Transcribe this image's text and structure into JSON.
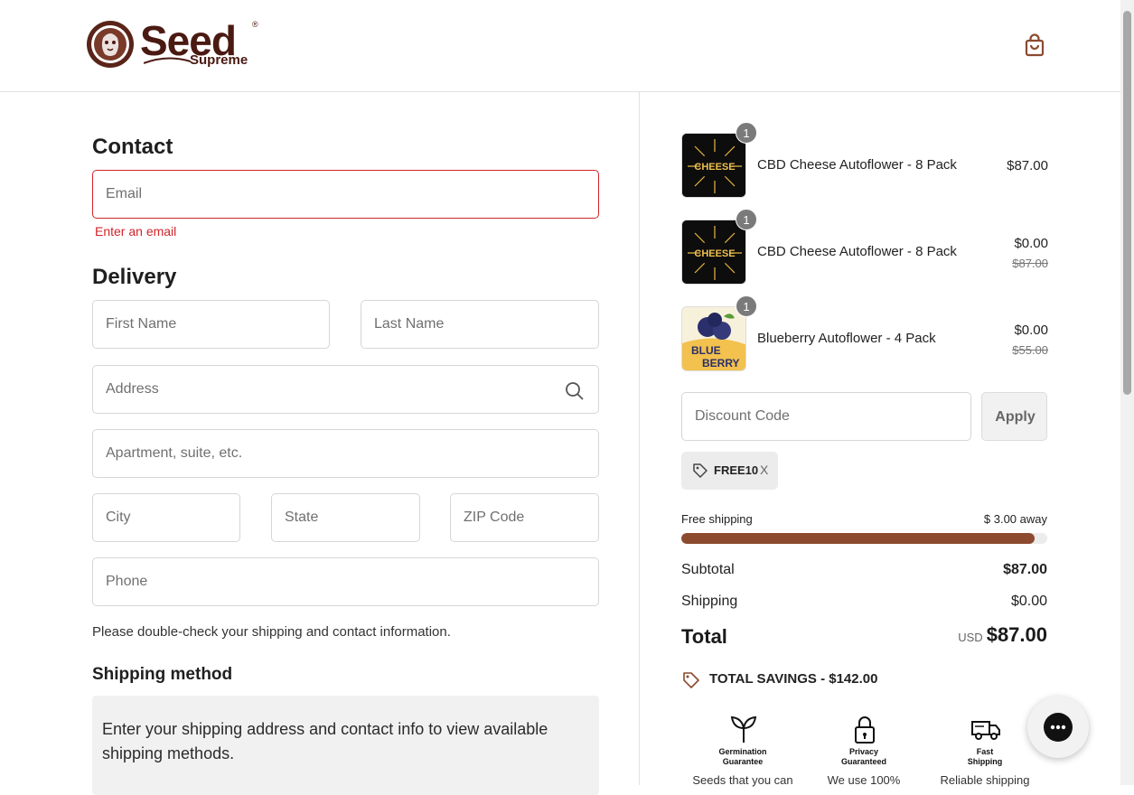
{
  "brand": {
    "name": "Seed",
    "sub": "Supreme",
    "reg": "®"
  },
  "contact": {
    "heading": "Contact",
    "email_placeholder": "Email",
    "email_error": "Enter an email"
  },
  "delivery": {
    "heading": "Delivery",
    "first_name": "First Name",
    "last_name": "Last Name",
    "address": "Address",
    "apartment": "Apartment, suite, etc.",
    "city": "City",
    "state": "State",
    "zip": "ZIP Code",
    "phone": "Phone",
    "note": "Please double-check your shipping and contact information."
  },
  "shipping_method": {
    "heading": "Shipping method",
    "message": "Enter your shipping address and contact info to view available shipping methods."
  },
  "cart": {
    "items": [
      {
        "qty": "1",
        "name": "CBD Cheese Autoflower - 8 Pack",
        "price": "$87.00",
        "original": "",
        "image": "cheese-product-image"
      },
      {
        "qty": "1",
        "name": "CBD Cheese Autoflower - 8 Pack",
        "price": "$0.00",
        "original": "$87.00",
        "image": "cheese-product-image"
      },
      {
        "qty": "1",
        "name": "Blueberry Autoflower - 4 Pack",
        "price": "$0.00",
        "original": "$55.00",
        "image": "blueberry-product-image"
      }
    ]
  },
  "discount": {
    "placeholder": "Discount Code",
    "apply_label": "Apply",
    "applied_code": "FREE10",
    "remove_label": "X"
  },
  "free_shipping": {
    "label": "Free shipping",
    "away": "$ 3.00 away",
    "progress": 0.966,
    "bar_color": "#8c4a2f"
  },
  "summary": {
    "subtotal_label": "Subtotal",
    "subtotal_value": "$87.00",
    "shipping_label": "Shipping",
    "shipping_value": "$0.00",
    "total_label": "Total",
    "currency": "USD",
    "total_value": "$87.00",
    "savings": "TOTAL SAVINGS - $142.00"
  },
  "badges": [
    {
      "icon": "sprout-icon",
      "title_line1": "Germination",
      "title_line2": "Guarantee",
      "subtitle": "Seeds that you can"
    },
    {
      "icon": "lock-icon",
      "title_line1": "Privacy",
      "title_line2": "Guaranteed",
      "subtitle": "We use 100%"
    },
    {
      "icon": "truck-icon",
      "title_line1": "Fast",
      "title_line2": "Shipping",
      "subtitle": "Reliable shipping"
    }
  ],
  "colors": {
    "accent": "#8c4a2f",
    "error": "#d0242a",
    "brand": "#4a1a12"
  }
}
